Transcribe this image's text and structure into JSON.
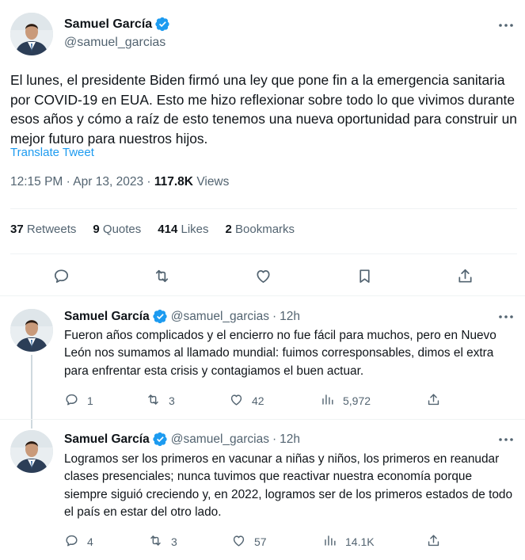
{
  "main_tweet": {
    "author_name": "Samuel García",
    "author_handle": "@samuel_garcias",
    "text": "El lunes, el presidente Biden firmó una ley que pone fin a la emergencia sanitaria por COVID-19 en EUA. Esto me hizo reflexionar sobre todo lo que vivimos durante esos años y cómo a raíz de esto tenemos una nueva oportunidad para construir un mejor futuro para nuestros hijos.",
    "translate_label": "Translate Tweet",
    "time": "12:15 PM",
    "separator": "·",
    "date": "Apr 13, 2023",
    "views_count": "117.8K",
    "views_label": "Views",
    "stats": {
      "retweets_count": "37",
      "retweets_label": "Retweets",
      "quotes_count": "9",
      "quotes_label": "Quotes",
      "likes_count": "414",
      "likes_label": "Likes",
      "bookmarks_count": "2",
      "bookmarks_label": "Bookmarks"
    }
  },
  "replies": [
    {
      "author_name": "Samuel García",
      "author_handle": "@samuel_garcias",
      "separator": "·",
      "age": "12h",
      "text": "Fueron años complicados y el encierro no fue fácil para muchos, pero en Nuevo León nos sumamos al llamado mundial: fuimos corresponsables, dimos el extra para enfrentar esta crisis y contagiamos el buen actuar.",
      "replies": "1",
      "retweets": "3",
      "likes": "42",
      "views": "5,972"
    },
    {
      "author_name": "Samuel García",
      "author_handle": "@samuel_garcias",
      "separator": "·",
      "age": "12h",
      "text": "Logramos ser los primeros en vacunar a niñas y niños, los primeros en reanudar clases presenciales; nunca tuvimos que reactivar nuestra economía porque siempre siguió creciendo y, en 2022, logramos ser de los primeros estados de todo el país en estar del otro lado.",
      "replies": "4",
      "retweets": "3",
      "likes": "57",
      "views": "14.1K"
    }
  ],
  "colors": {
    "text_primary": "#0f1419",
    "text_secondary": "#536471",
    "accent": "#1d9bf0",
    "divider": "#eff3f4",
    "thread_line": "#cfd9de"
  },
  "icons": {
    "verified": "verified-badge-icon",
    "more": "more-icon",
    "reply": "reply-icon",
    "retweet": "retweet-icon",
    "like": "like-icon",
    "bookmark": "bookmark-icon",
    "share": "share-icon",
    "views": "views-icon"
  }
}
